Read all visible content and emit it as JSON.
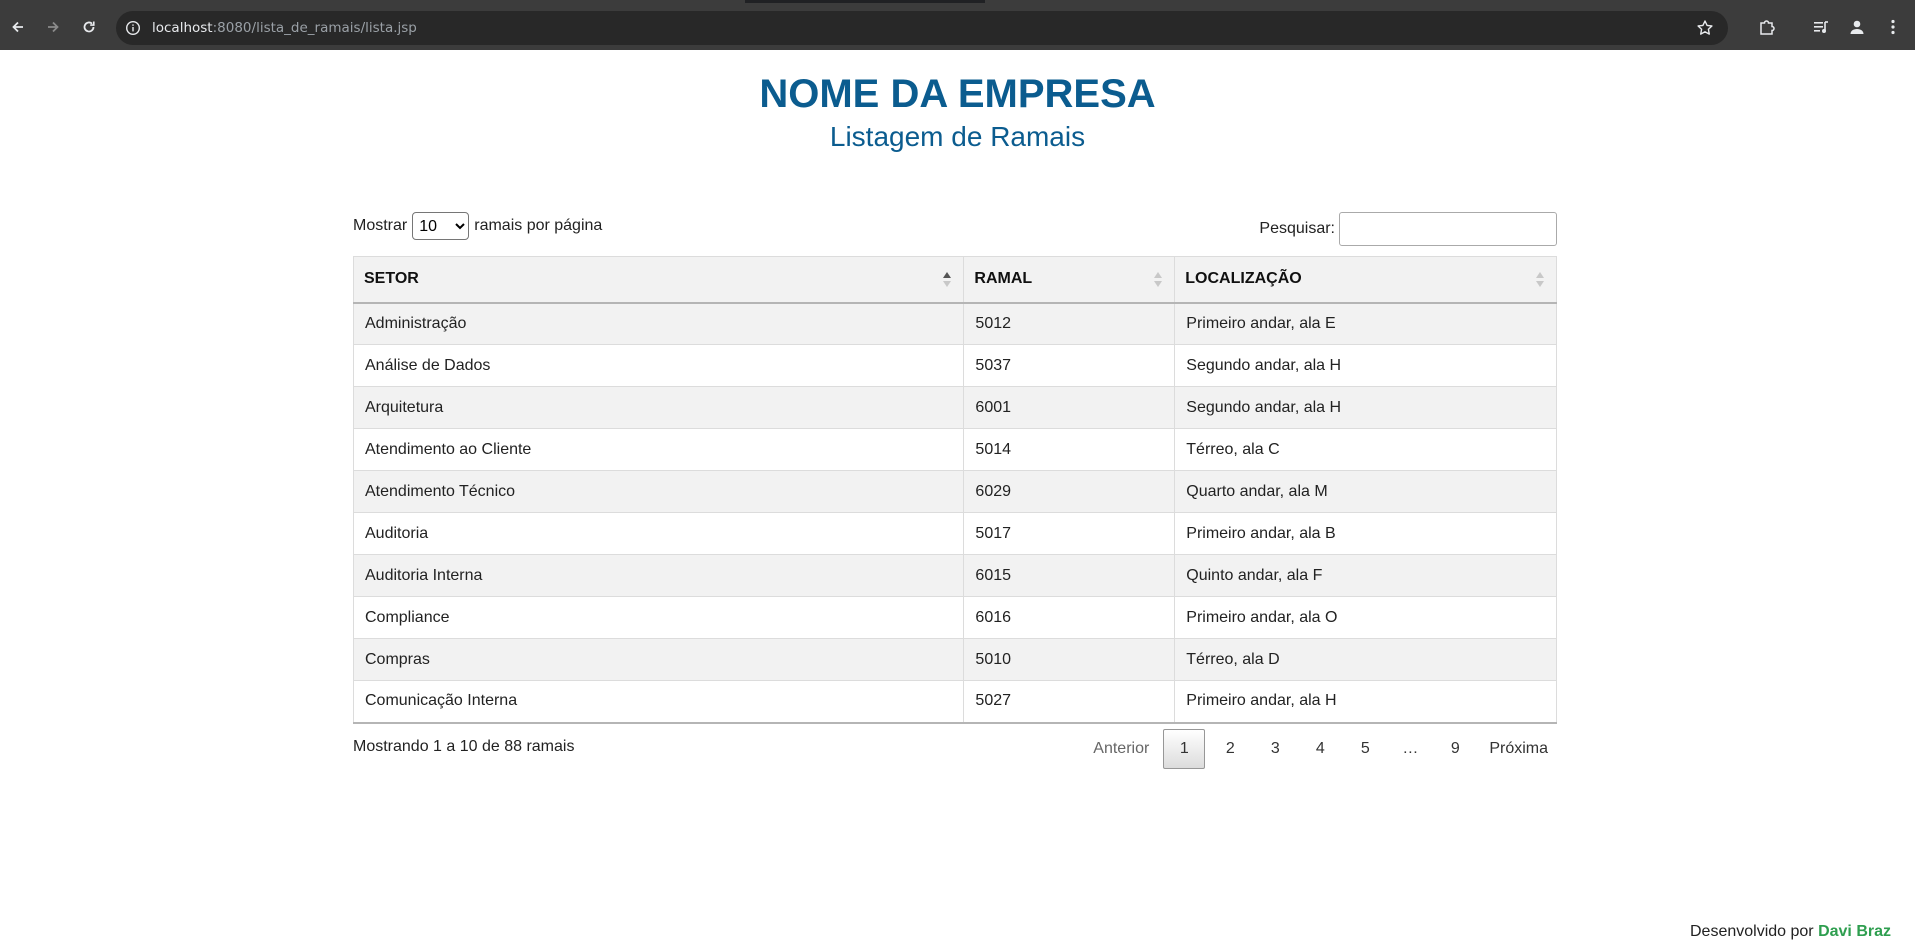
{
  "browser": {
    "url_host": "localhost",
    "url_rest": ":8080/lista_de_ramais/lista.jsp"
  },
  "header": {
    "company": "NOME DA EMPRESA",
    "subtitle": "Listagem de Ramais"
  },
  "controls": {
    "show_prefix": "Mostrar",
    "page_length": "10",
    "page_length_options": [
      "10"
    ],
    "show_suffix": "ramais por página",
    "search_label": "Pesquisar:",
    "search_value": ""
  },
  "table": {
    "columns": [
      "SETOR",
      "RAMAL",
      "LOCALIZAÇÃO"
    ],
    "rows": [
      [
        "Administração",
        "5012",
        "Primeiro andar, ala E"
      ],
      [
        "Análise de Dados",
        "5037",
        "Segundo andar, ala H"
      ],
      [
        "Arquitetura",
        "6001",
        "Segundo andar, ala H"
      ],
      [
        "Atendimento ao Cliente",
        "5014",
        "Térreo, ala C"
      ],
      [
        "Atendimento Técnico",
        "6029",
        "Quarto andar, ala M"
      ],
      [
        "Auditoria",
        "5017",
        "Primeiro andar, ala B"
      ],
      [
        "Auditoria Interna",
        "6015",
        "Quinto andar, ala F"
      ],
      [
        "Compliance",
        "6016",
        "Primeiro andar, ala O"
      ],
      [
        "Compras",
        "5010",
        "Térreo, ala D"
      ],
      [
        "Comunicação Interna",
        "5027",
        "Primeiro andar, ala H"
      ]
    ]
  },
  "info": "Mostrando 1 a 10 de 88 ramais",
  "pagination": {
    "previous": "Anterior",
    "pages": [
      "1",
      "2",
      "3",
      "4",
      "5",
      "…",
      "9"
    ],
    "next": "Próxima"
  },
  "footer": {
    "prefix": "Desenvolvido por",
    "author": "Davi Braz"
  },
  "colors": {
    "title": "#0b5c8f",
    "author": "#2e9e4f",
    "stripe": "#f2f2f2"
  }
}
